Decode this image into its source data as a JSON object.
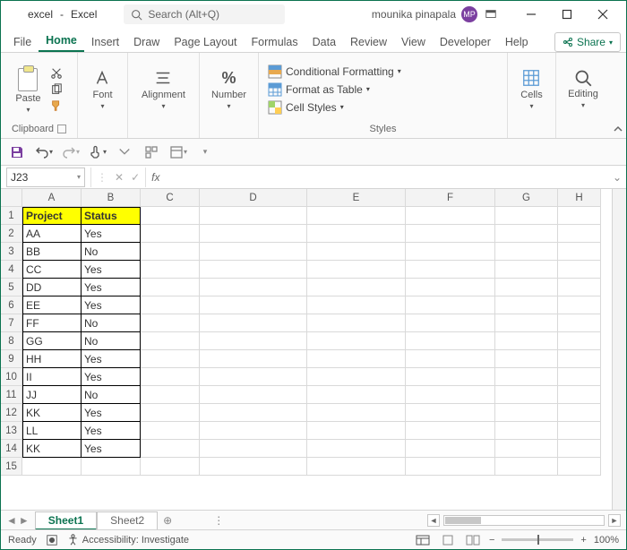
{
  "title": {
    "doc": "excel",
    "app": "Excel"
  },
  "search": {
    "placeholder": "Search (Alt+Q)"
  },
  "user": {
    "name": "mounika pinapala",
    "initials": "MP"
  },
  "tabs": [
    "File",
    "Home",
    "Insert",
    "Draw",
    "Page Layout",
    "Formulas",
    "Data",
    "Review",
    "View",
    "Developer",
    "Help"
  ],
  "active_tab": "Home",
  "share_label": "Share",
  "ribbon": {
    "clipboard": {
      "paste": "Paste",
      "label": "Clipboard"
    },
    "font": {
      "btn": "Font"
    },
    "alignment": {
      "btn": "Alignment"
    },
    "number": {
      "btn": "Number"
    },
    "styles": {
      "cond": "Conditional Formatting",
      "table": "Format as Table",
      "cellstyles": "Cell Styles",
      "label": "Styles"
    },
    "cells": {
      "btn": "Cells"
    },
    "editing": {
      "btn": "Editing"
    }
  },
  "namebox": "J23",
  "fx_label": "fx",
  "columns": [
    "A",
    "B",
    "C",
    "D",
    "E",
    "F",
    "G",
    "H"
  ],
  "rows": [
    {
      "n": 1,
      "a": "Project",
      "b": "Status",
      "hdr": true
    },
    {
      "n": 2,
      "a": "AA",
      "b": "Yes"
    },
    {
      "n": 3,
      "a": "BB",
      "b": "No"
    },
    {
      "n": 4,
      "a": "CC",
      "b": "Yes"
    },
    {
      "n": 5,
      "a": "DD",
      "b": "Yes"
    },
    {
      "n": 6,
      "a": "EE",
      "b": "Yes"
    },
    {
      "n": 7,
      "a": "FF",
      "b": "No"
    },
    {
      "n": 8,
      "a": "GG",
      "b": "No"
    },
    {
      "n": 9,
      "a": "HH",
      "b": "Yes"
    },
    {
      "n": 10,
      "a": "II",
      "b": "Yes"
    },
    {
      "n": 11,
      "a": "JJ",
      "b": "No"
    },
    {
      "n": 12,
      "a": "KK",
      "b": "Yes"
    },
    {
      "n": 13,
      "a": "LL",
      "b": "Yes"
    },
    {
      "n": 14,
      "a": "KK",
      "b": "Yes"
    },
    {
      "n": 15,
      "a": "",
      "b": ""
    }
  ],
  "sheets": [
    "Sheet1",
    "Sheet2"
  ],
  "active_sheet": "Sheet1",
  "status": {
    "ready": "Ready",
    "accessibility": "Accessibility: Investigate",
    "zoom": "100%"
  }
}
